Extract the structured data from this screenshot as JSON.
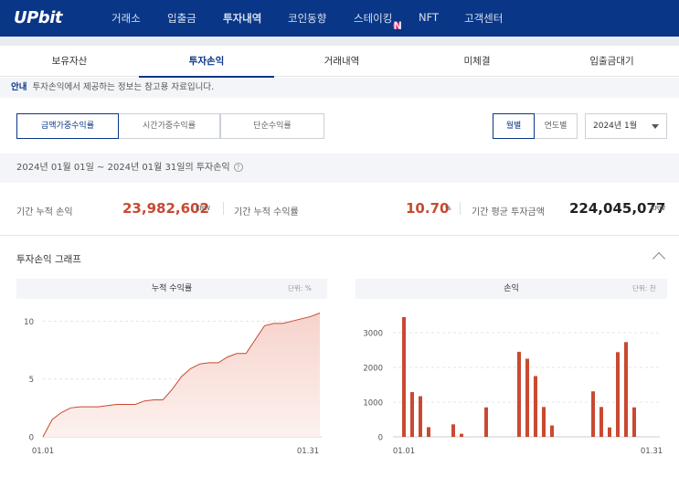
{
  "header": {
    "logo": "UPbit",
    "nav": [
      {
        "label": "거래소",
        "active": false,
        "badge": ""
      },
      {
        "label": "입출금",
        "active": false,
        "badge": ""
      },
      {
        "label": "투자내역",
        "active": true,
        "badge": ""
      },
      {
        "label": "코인동향",
        "active": false,
        "badge": ""
      },
      {
        "label": "스테이킹",
        "active": false,
        "badge": "N"
      },
      {
        "label": "NFT",
        "active": false,
        "badge": ""
      },
      {
        "label": "고객센터",
        "active": false,
        "badge": ""
      }
    ]
  },
  "tabs": [
    {
      "label": "보유자산",
      "active": false
    },
    {
      "label": "투자손익",
      "active": true
    },
    {
      "label": "거래내역",
      "active": false
    },
    {
      "label": "미체결",
      "active": false
    },
    {
      "label": "입출금대기",
      "active": false
    }
  ],
  "notice": {
    "tag": "안내",
    "text": "투자손익에서 제공하는 정보는 참고용 자료입니다."
  },
  "filters": {
    "types": [
      {
        "label": "금액가중수익률",
        "active": true
      },
      {
        "label": "시간가중수익률",
        "active": false
      },
      {
        "label": "단순수익률",
        "active": false
      }
    ],
    "periods": [
      {
        "label": "월별",
        "active": true
      },
      {
        "label": "연도별",
        "active": false
      }
    ],
    "month_select": "2024년 1월"
  },
  "period_text": "2024년 01월 01일 ~ 2024년 01월 31일의 투자손익",
  "summary": {
    "cum_profit_label": "기간 누적 손익",
    "cum_profit_value": "23,982,602",
    "cum_profit_unit": "KRW",
    "cum_rate_label": "기간 누적 수익률",
    "cum_rate_value": "10.70",
    "cum_rate_unit": "%",
    "avg_invest_label": "기간 평균 투자금액",
    "avg_invest_value": "224,045,077",
    "avg_invest_unit": "KRW"
  },
  "graph_section": {
    "title": "투자손익 그래프"
  },
  "colors": {
    "brand": "#093687",
    "profit": "#c84a31",
    "area_fill": "#f6d3cc"
  },
  "chart_data": [
    {
      "type": "area",
      "title": "누적 수익률",
      "unit_label": "단위: %",
      "x_tick_labels": [
        "01.01",
        "01.31"
      ],
      "y_ticks": [
        0,
        5,
        10
      ],
      "ylim": [
        0,
        10.5
      ],
      "x": [
        1,
        2,
        3,
        4,
        5,
        6,
        7,
        8,
        9,
        10,
        11,
        12,
        13,
        14,
        15,
        16,
        17,
        18,
        19,
        20,
        21,
        22,
        23,
        24,
        25,
        26,
        27,
        28,
        29,
        30,
        31
      ],
      "values": [
        0,
        1.5,
        2.1,
        2.5,
        2.6,
        2.6,
        2.6,
        2.7,
        2.8,
        2.8,
        2.8,
        3.1,
        3.2,
        3.2,
        4.1,
        5.2,
        5.9,
        6.3,
        6.4,
        6.4,
        6.9,
        7.2,
        7.2,
        8.4,
        9.6,
        9.8,
        9.8,
        10.0,
        10.2,
        10.4,
        10.7
      ],
      "grid": true
    },
    {
      "type": "bar",
      "title": "손익",
      "unit_label": "단위: 천",
      "x_tick_labels": [
        "01.01",
        "01.31"
      ],
      "y_ticks": [
        0,
        1000,
        2000,
        3000
      ],
      "ylim": [
        0,
        3500
      ],
      "x": [
        1,
        2,
        3,
        4,
        5,
        6,
        7,
        8,
        9,
        10,
        11,
        12,
        13,
        14,
        15,
        16,
        17,
        18,
        19,
        20,
        21,
        22,
        23,
        24,
        25,
        26,
        27,
        28,
        29,
        30,
        31
      ],
      "values": [
        3450,
        1290,
        1170,
        280,
        0,
        0,
        360,
        90,
        0,
        0,
        850,
        0,
        0,
        0,
        2450,
        2250,
        1750,
        860,
        330,
        0,
        0,
        0,
        0,
        1310,
        860,
        270,
        2440,
        2730,
        850,
        0,
        0
      ],
      "grid": true
    }
  ]
}
